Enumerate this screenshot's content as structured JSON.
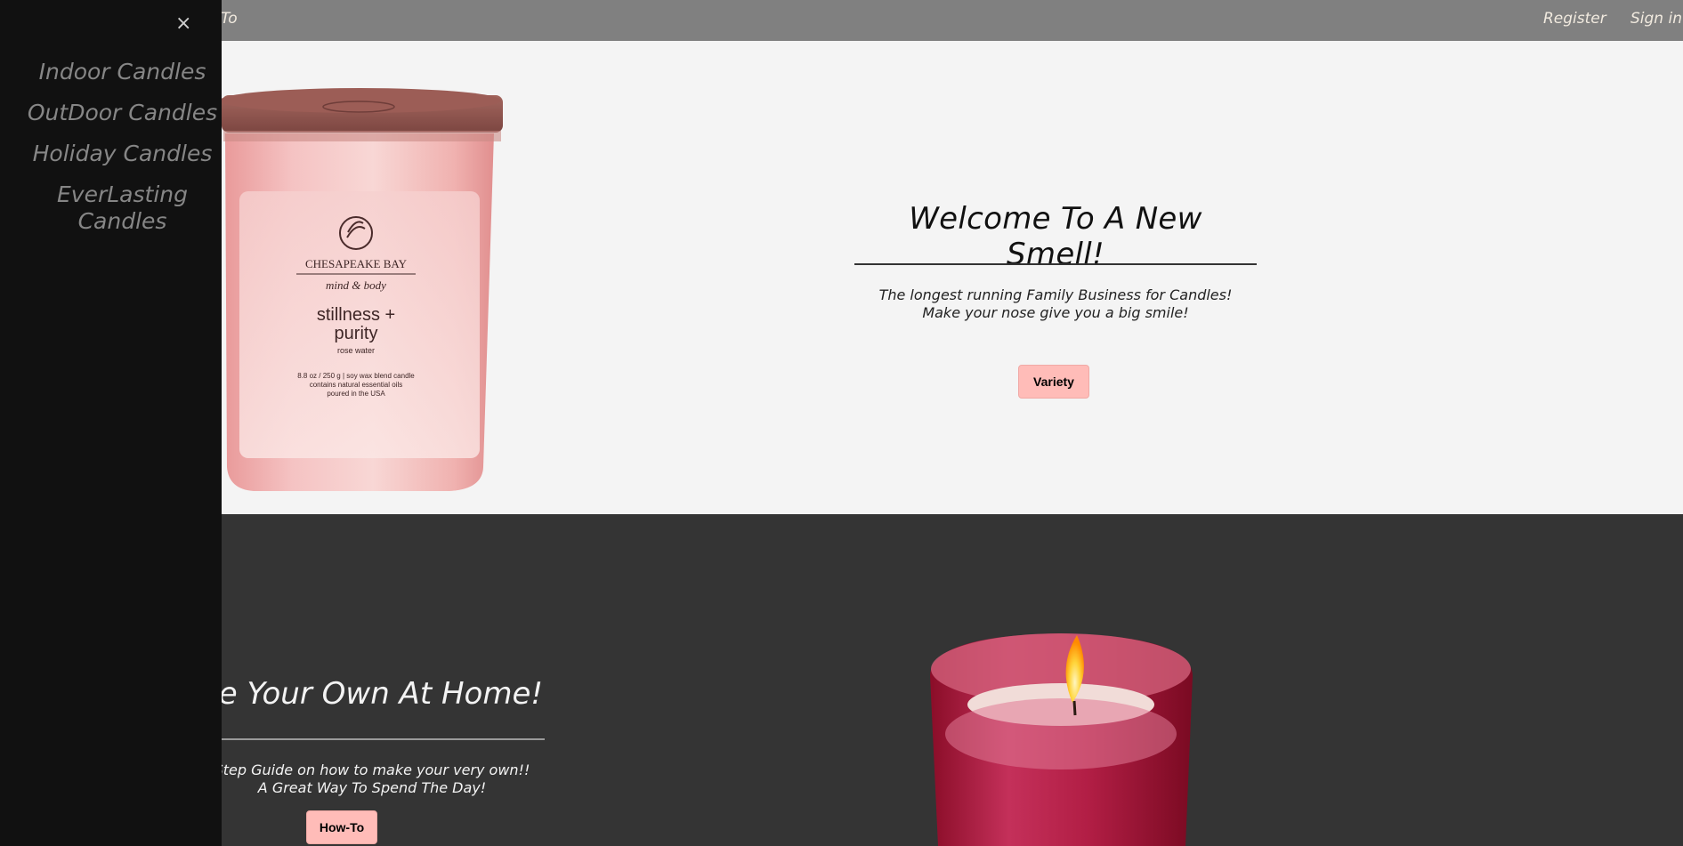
{
  "nav": {
    "partial_link": "To",
    "register": "Register",
    "sign_in": "Sign in"
  },
  "drawer": {
    "close_icon": "close-icon",
    "items": [
      {
        "label": "Indoor Candles"
      },
      {
        "label": "OutDoor Candles"
      },
      {
        "label": "Holiday Candles"
      },
      {
        "label": "EverLasting Candles"
      }
    ]
  },
  "hero1": {
    "title": "Welcome To A New Smell!",
    "line1": "The longest running Family Business for Candles!",
    "line2": "Make your nose give you a big smile!",
    "button": "Variety",
    "jar_label": {
      "brand": "CHESAPEAKE BAY",
      "line": "mind & body",
      "scent1": "stillness +",
      "scent2": "purity",
      "note": "rose water",
      "spec1": "8.8 oz / 250 g | soy wax blend candle",
      "spec2": "contains natural essential oils",
      "spec3": "poured in the USA"
    }
  },
  "hero2": {
    "title": "te Your Own At Home!",
    "line1": "Step Guide on how to make your very own!!",
    "line2": "A Great Way To Spend The Day!",
    "button": "How-To"
  },
  "colors": {
    "topbar": "#808080",
    "drawer": "#111111",
    "hero1_bg": "#f4f4f4",
    "hero2_bg": "#343434",
    "button": "#ffbcb8"
  }
}
